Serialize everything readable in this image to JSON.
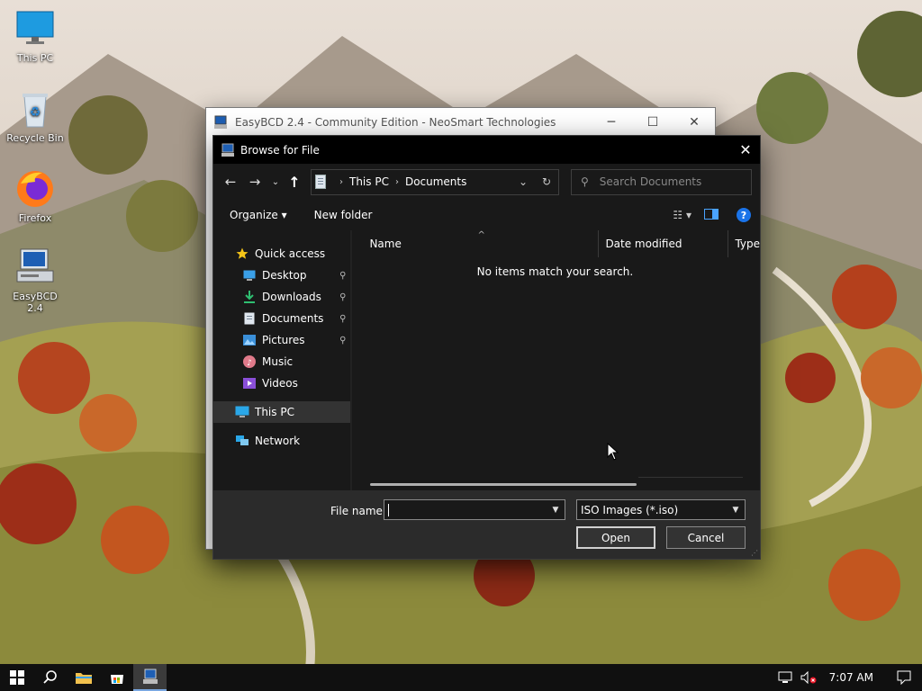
{
  "desktop": {
    "icons": [
      {
        "label": "This PC",
        "icon": "monitor-icon"
      },
      {
        "label": "Recycle Bin",
        "icon": "recycle-bin-icon"
      },
      {
        "label": "Firefox",
        "icon": "firefox-icon"
      },
      {
        "label": "EasyBCD 2.4",
        "icon": "easybcd-icon"
      }
    ]
  },
  "app_window": {
    "title": "EasyBCD 2.4 - Community Edition - NeoSmart Technologies",
    "minimize": "─",
    "maximize": "☐",
    "close": "✕"
  },
  "dialog": {
    "title": "Browse for File",
    "close": "✕",
    "nav": {
      "back": "←",
      "forward": "→",
      "recent": "⌄",
      "up": "↑"
    },
    "address": {
      "crumbs": [
        "This PC",
        "Documents"
      ],
      "separator": "›",
      "dropdown": "⌄",
      "refresh": "↻"
    },
    "search": {
      "placeholder": "Search Documents",
      "icon": "⚲"
    },
    "toolbar": {
      "organize": "Organize ▾",
      "new_folder": "New folder",
      "view": "☷ ▾",
      "help": "?"
    },
    "nav_pane": {
      "quick_access": "Quick access",
      "items": [
        {
          "label": "Desktop",
          "pinned": true
        },
        {
          "label": "Downloads",
          "pinned": true
        },
        {
          "label": "Documents",
          "pinned": true
        },
        {
          "label": "Pictures",
          "pinned": true
        },
        {
          "label": "Music",
          "pinned": false
        },
        {
          "label": "Videos",
          "pinned": false
        }
      ],
      "this_pc": "This PC",
      "network": "Network",
      "pin_glyph": "📌"
    },
    "columns": {
      "name": "Name",
      "date_modified": "Date modified",
      "type": "Type",
      "sort_caret": "^"
    },
    "empty_message": "No items match your search.",
    "footer": {
      "file_name_label": "File name:",
      "file_name_value": "",
      "filter_value": "ISO Images (*.iso)",
      "open": "Open",
      "cancel": "Cancel"
    }
  },
  "taskbar": {
    "clock": "7:07 AM"
  },
  "colors": {
    "dialog_bg": "#191919",
    "footer_bg": "#2b2b2b",
    "accent": "#1a73e8",
    "taskbar_bg": "#101010"
  }
}
